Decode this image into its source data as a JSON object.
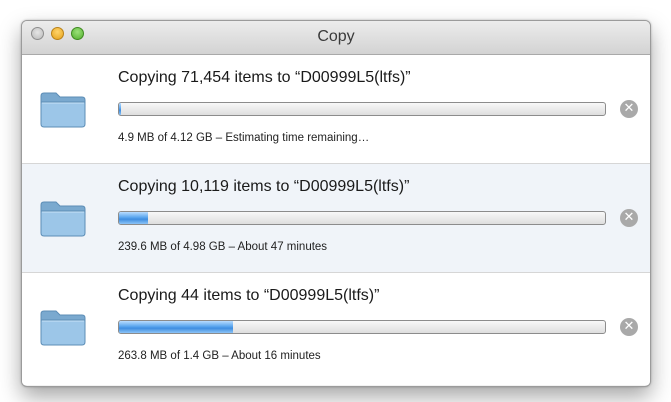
{
  "window": {
    "title": "Copy"
  },
  "colors": {
    "progress_fill": "#4a97e6",
    "row_alternate": "#f0f4f9",
    "cancel_button": "#a9a9a9"
  },
  "icons": {
    "folder": "folder-icon",
    "cancel": "cancel-icon"
  },
  "copies": [
    {
      "title": "Copying 71,454 items to “D00999L5(ltfs)”",
      "status": "4.9 MB of 4.12 GB – Estimating time remaining…",
      "progress": 0.005
    },
    {
      "title": "Copying 10,119 items to “D00999L5(ltfs)”",
      "status": "239.6 MB of 4.98 GB – About 47 minutes",
      "progress": 0.06
    },
    {
      "title": "Copying 44 items to “D00999L5(ltfs)”",
      "status": "263.8 MB of 1.4 GB – About 16 minutes",
      "progress": 0.235
    }
  ]
}
